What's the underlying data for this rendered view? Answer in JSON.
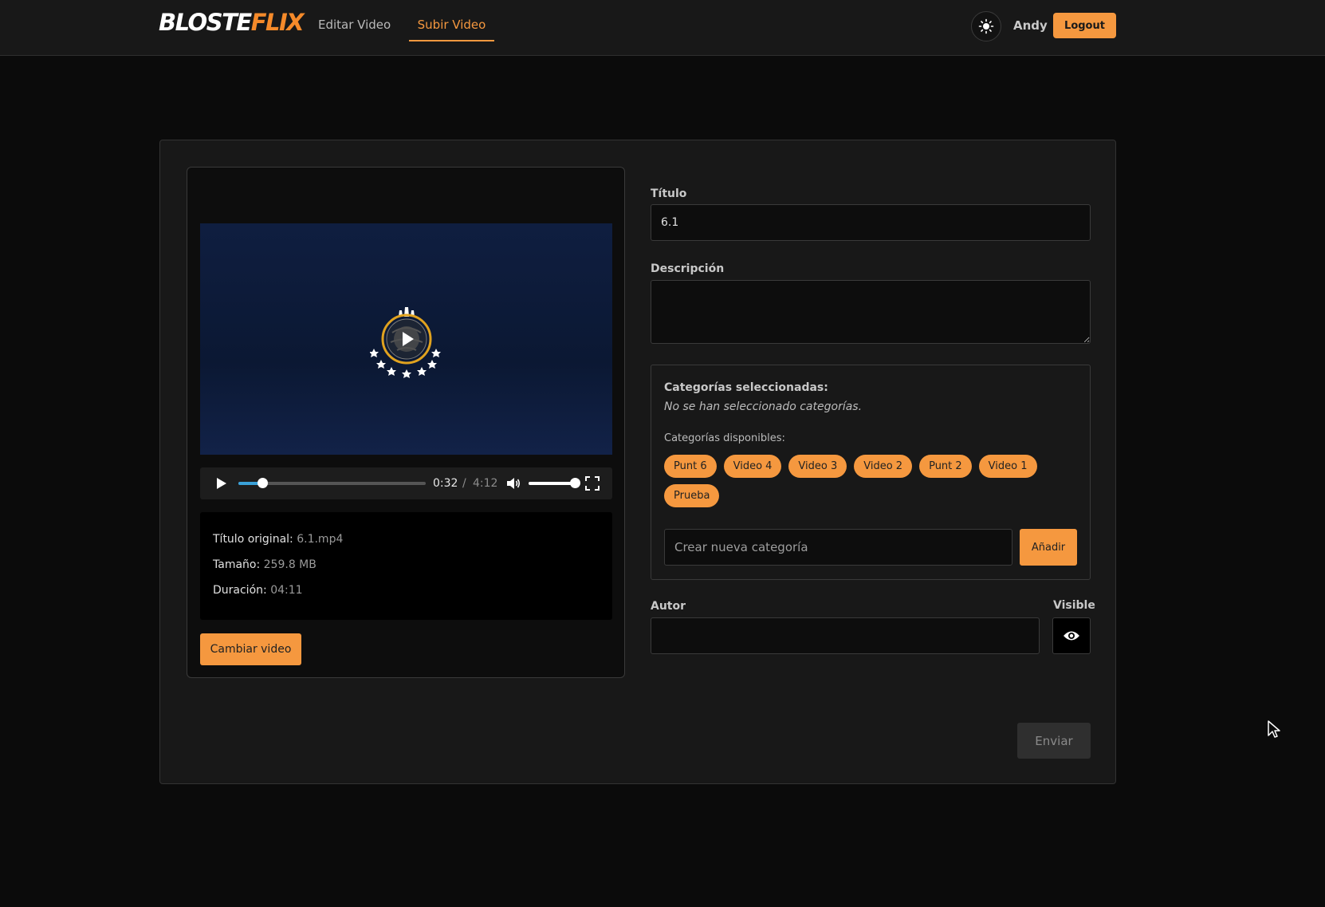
{
  "navbar": {
    "logo_part1": "BLOSTE",
    "logo_part2": "FLIX",
    "links": [
      {
        "label": "Editar Video",
        "active": false
      },
      {
        "label": "Subir Video",
        "active": true
      }
    ],
    "theme_icon": "sun-icon",
    "user_name": "Andy",
    "logout_label": "Logout"
  },
  "video": {
    "current_time": "0:32",
    "separator": "/",
    "total_time": "4:12",
    "progress_fraction": 0.127,
    "volume_fraction": 1.0,
    "icons": [
      "play-icon",
      "volume-icon",
      "fullscreen-icon"
    ]
  },
  "info": {
    "original_title_label": "Título original:",
    "original_title_value": "6.1.mp4",
    "size_label": "Tamaño:",
    "size_value": "259.8 MB",
    "duration_label": "Duración:",
    "duration_value": "04:11"
  },
  "change_video_label": "Cambiar video",
  "form": {
    "title_label": "Título",
    "title_value": "6.1",
    "description_label": "Descripción",
    "description_value": "",
    "selected_categories_label": "Categorías seleccionadas:",
    "no_categories_text": "No se han seleccionado categorías.",
    "available_categories_label": "Categorías disponibles:",
    "available_categories": [
      "Punt 6",
      "Video 4",
      "Video 3",
      "Video 2",
      "Punt 2",
      "Video 1",
      "Prueba"
    ],
    "new_category_placeholder": "Crear nueva categoría",
    "add_label": "Añadir",
    "author_label": "Autor",
    "author_value": "",
    "visible_label": "Visible",
    "visible_icon": "eye-icon",
    "submit_label": "Enviar"
  },
  "colors": {
    "accent": "#f5983f",
    "background": "#0b0b0b",
    "card": "#181818",
    "progress": "#3aa1d8"
  }
}
